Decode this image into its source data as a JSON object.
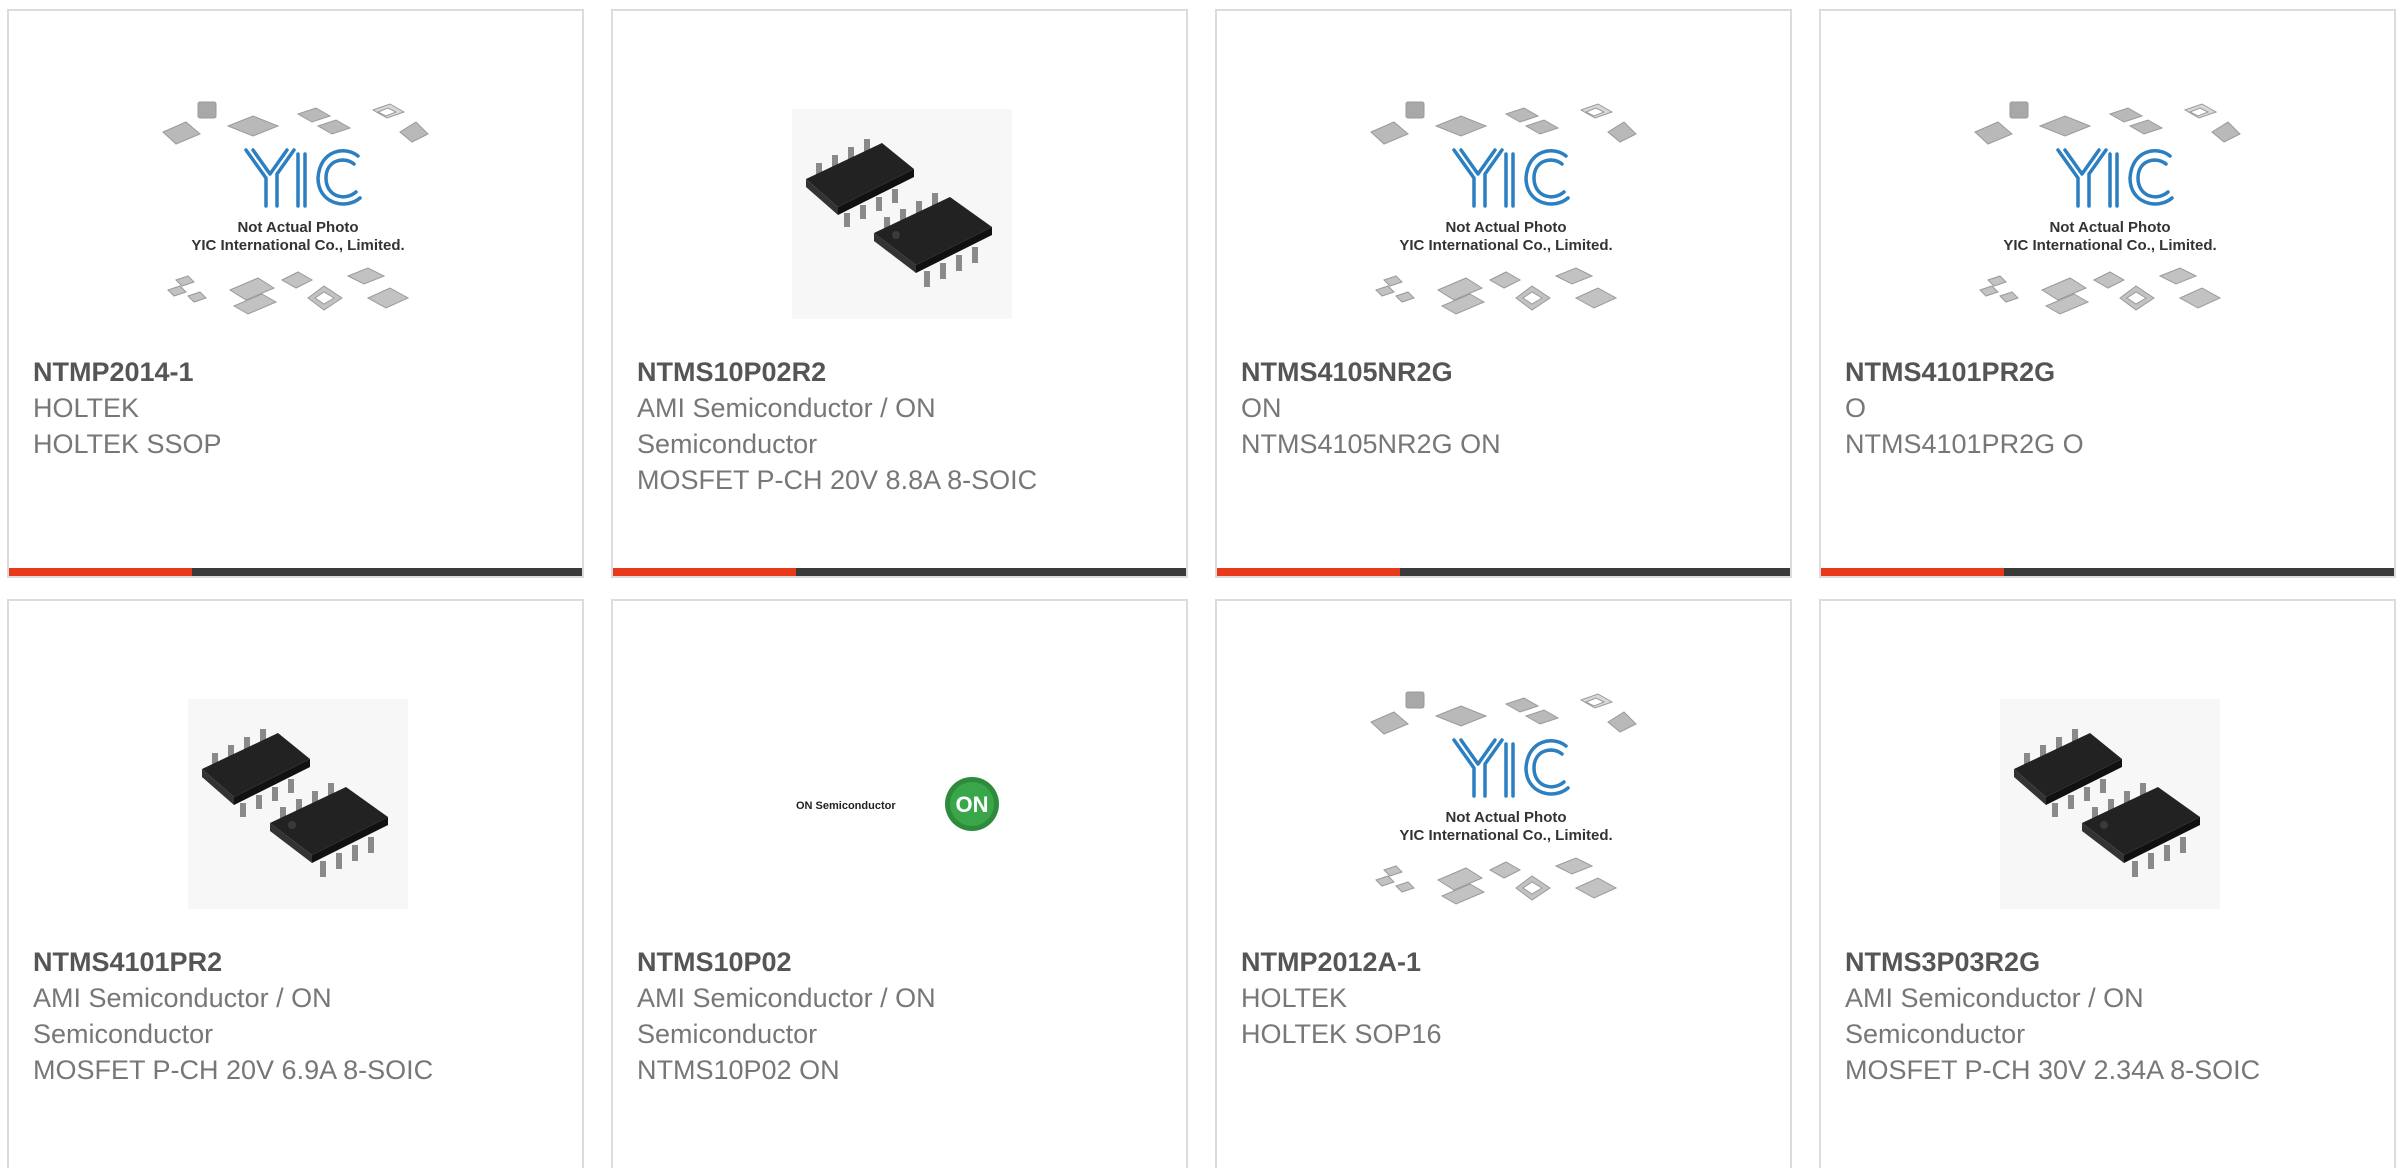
{
  "colors": {
    "accent": "#e8391a",
    "bar": "#3a3a3a",
    "pn_text": "#555555",
    "body_text": "#777777",
    "border": "#dcdcdc"
  },
  "placeholder": {
    "line1": "Not Actual Photo",
    "line2": "YIC International Co., Limited."
  },
  "onsemi_logo": {
    "text": "ON Semiconductor",
    "badge": "ON"
  },
  "products": [
    {
      "part_number": "NTMP2014-1",
      "manufacturer": "HOLTEK",
      "description": "HOLTEK SSOP",
      "image": "yic-placeholder"
    },
    {
      "part_number": "NTMS10P02R2",
      "manufacturer": "AMI Semiconductor / ON Semiconductor",
      "description": "MOSFET P-CH 20V 8.8A 8-SOIC",
      "image": "soic-chip"
    },
    {
      "part_number": "NTMS4105NR2G",
      "manufacturer": "ON",
      "description": "NTMS4105NR2G ON",
      "image": "yic-placeholder"
    },
    {
      "part_number": "NTMS4101PR2G",
      "manufacturer": "O",
      "description": "NTMS4101PR2G O",
      "image": "yic-placeholder"
    },
    {
      "part_number": "NTMS4101PR2",
      "manufacturer": "AMI Semiconductor / ON Semiconductor",
      "description": "MOSFET P-CH 20V 6.9A 8-SOIC",
      "image": "soic-chip"
    },
    {
      "part_number": "NTMS10P02",
      "manufacturer": "AMI Semiconductor / ON Semiconductor",
      "description": "NTMS10P02 ON",
      "image": "on-semi-logo"
    },
    {
      "part_number": "NTMP2012A-1",
      "manufacturer": "HOLTEK",
      "description": "HOLTEK SOP16",
      "image": "yic-placeholder"
    },
    {
      "part_number": "NTMS3P03R2G",
      "manufacturer": "AMI Semiconductor / ON Semiconductor",
      "description": "MOSFET P-CH 30V 2.34A 8-SOIC",
      "image": "soic-chip"
    }
  ]
}
